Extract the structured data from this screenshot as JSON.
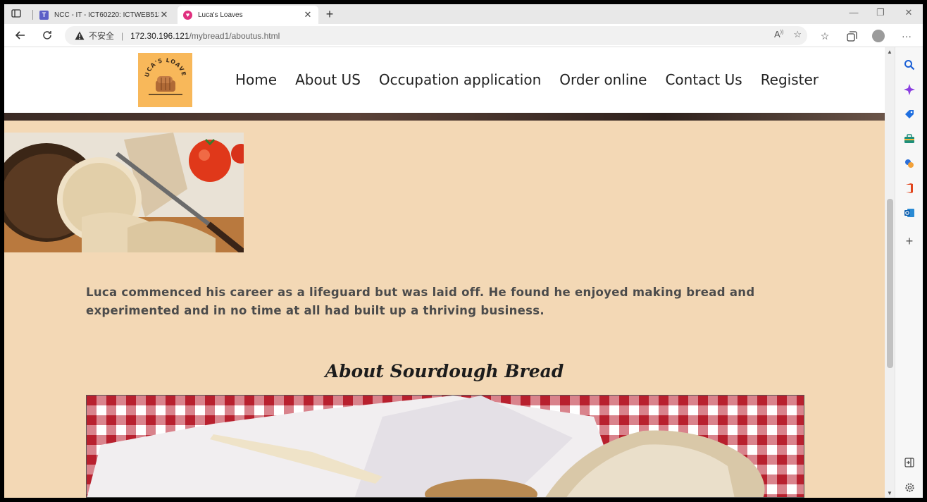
{
  "browser": {
    "tabs": [
      {
        "label": "NCC - IT - ICT60220: ICTWEB513",
        "icon": "teams-icon",
        "active": false
      },
      {
        "label": "Luca's Loaves",
        "icon": "site-favicon",
        "active": true
      }
    ],
    "address": {
      "insecure_label": "不安全",
      "separator": "|",
      "host": "172.30.196.121",
      "path": "/mybread1/aboutus.html"
    }
  },
  "site": {
    "logo_text": "LUCA'S LOAVES",
    "nav": [
      "Home",
      "About US",
      "Occupation application",
      "Order online",
      "Contact Us",
      "Register"
    ],
    "intro": "Luca commenced his career as a lifeguard but was laid off. He found he enjoyed making bread and experimented and in no time at all had built up a thriving business.",
    "heading": "About Sourdough Bread"
  },
  "colors": {
    "page_bg": "#f3d8b5",
    "logo_bg": "#f8b85a",
    "text": "#4b4b4b"
  }
}
